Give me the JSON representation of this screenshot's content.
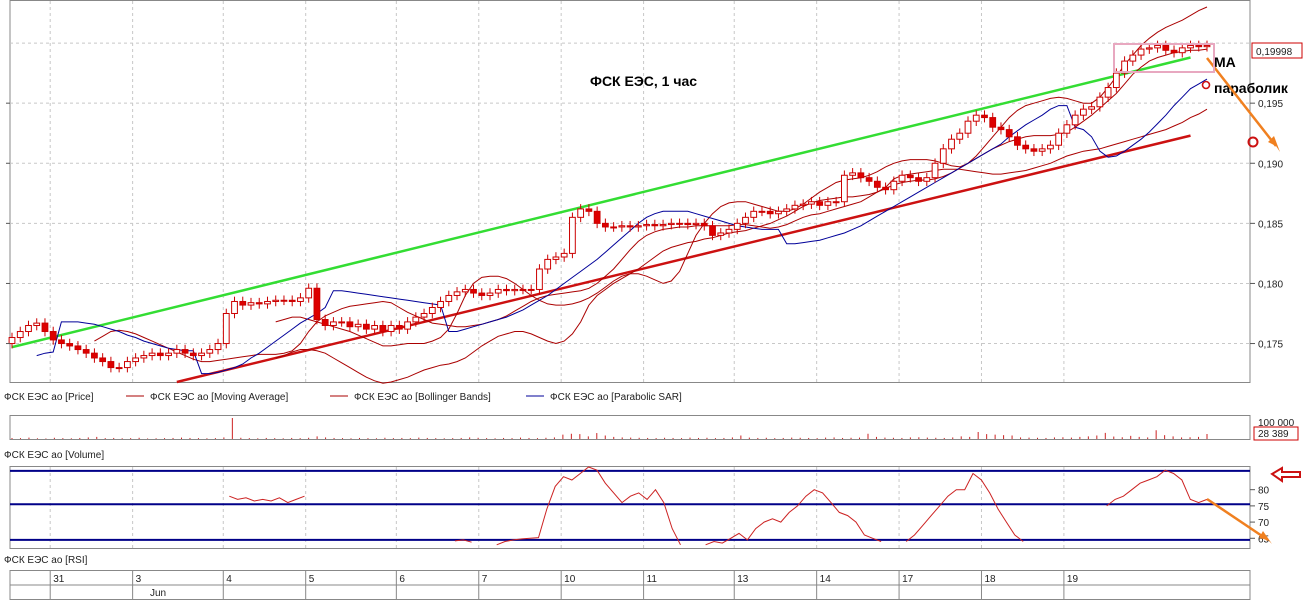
{
  "colors": {
    "grid": "#c8c8c8",
    "candle_up": "#ffffff",
    "candle_down": "#dd0000",
    "candle_outline": "#cc0000",
    "moving_average": "#aa0000",
    "bollinger": "#aa0000",
    "parabolic_sar": "#000099",
    "trend_green": "#33dd33",
    "trend_red": "#cc1111",
    "arrow_orange": "#f08020",
    "rsi_band": "#000088",
    "rsi_line": "#cc2222",
    "highlight_box": "#e8a8c0",
    "last_price_label": "#cc0000"
  },
  "chart_data": [
    {
      "type": "candlestick",
      "title": "ФСК ЕЭС,  1 час",
      "yticks": [
        0.175,
        0.18,
        0.185,
        0.19,
        0.195
      ],
      "ytick_labels": [
        "0,175",
        "0,180",
        "0,185",
        "0,190",
        "0,195"
      ],
      "ylim": [
        0.1718,
        0.2035
      ],
      "last_price_label": "0,19998",
      "legend": [
        "ФСК ЕЭС ао [Price]",
        "ФСК ЕЭС ао [Moving Average]",
        "ФСК ЕЭС ао [Bollinger Bands]",
        "ФСК ЕЭС ао [Parabolic SAR]"
      ],
      "annotations": [
        "МА",
        "параболик"
      ],
      "x_labels": [
        "31",
        "3",
        "4",
        "5",
        "6",
        "7",
        "10",
        "11",
        "13",
        "14",
        "17",
        "18",
        "19"
      ],
      "month_label": "Jun",
      "trendlines": [
        {
          "name": "upper",
          "from": [
            0,
            0.1747
          ],
          "to": [
            143,
            0.1988
          ]
        },
        {
          "name": "lower",
          "from": [
            20,
            0.1718
          ],
          "to": [
            143,
            0.1923
          ]
        }
      ],
      "closes": [
        0.1755,
        0.176,
        0.1765,
        0.1767,
        0.176,
        0.1753,
        0.175,
        0.1748,
        0.1745,
        0.1742,
        0.1738,
        0.1735,
        0.173,
        0.173,
        0.1735,
        0.1738,
        0.174,
        0.1742,
        0.174,
        0.1742,
        0.1745,
        0.1742,
        0.174,
        0.1742,
        0.1745,
        0.175,
        0.1775,
        0.1785,
        0.1782,
        0.1784,
        0.1783,
        0.1785,
        0.1786,
        0.1786,
        0.1785,
        0.1788,
        0.1796,
        0.177,
        0.1765,
        0.1768,
        0.1768,
        0.1764,
        0.1766,
        0.1762,
        0.1765,
        0.176,
        0.1765,
        0.1762,
        0.1768,
        0.1772,
        0.1775,
        0.178,
        0.1785,
        0.179,
        0.1793,
        0.1795,
        0.1792,
        0.179,
        0.1792,
        0.1795,
        0.1794,
        0.1795,
        0.1795,
        0.1795,
        0.1812,
        0.182,
        0.1822,
        0.1825,
        0.1855,
        0.1862,
        0.186,
        0.185,
        0.1847,
        0.1847,
        0.1848,
        0.1847,
        0.1848,
        0.1849,
        0.1848,
        0.1849,
        0.185,
        0.185,
        0.1849,
        0.185,
        0.1848,
        0.184,
        0.1842,
        0.1845,
        0.185,
        0.1855,
        0.186,
        0.186,
        0.1858,
        0.186,
        0.1862,
        0.1865,
        0.1866,
        0.1868,
        0.1865,
        0.1868,
        0.1868,
        0.189,
        0.1892,
        0.1888,
        0.1885,
        0.188,
        0.1878,
        0.1885,
        0.189,
        0.1888,
        0.1885,
        0.1888,
        0.19,
        0.1912,
        0.192,
        0.1925,
        0.1935,
        0.194,
        0.1938,
        0.193,
        0.1928,
        0.1922,
        0.1915,
        0.1912,
        0.191,
        0.1912,
        0.1915,
        0.1925,
        0.1932,
        0.194,
        0.1945,
        0.1947,
        0.1955,
        0.1963,
        0.1975,
        0.1985,
        0.199,
        0.1995,
        0.1996,
        0.1998,
        0.1994,
        0.1992,
        0.1996,
        0.1998,
        0.1997,
        0.1998
      ],
      "moving_average": [
        0.1752,
        0.1756,
        0.176,
        0.1761,
        0.176,
        0.1758,
        0.1755,
        0.1752,
        0.1749,
        0.1746,
        0.1743,
        0.174,
        0.1737,
        0.1735,
        0.1735,
        0.1736,
        0.1737,
        0.1738,
        0.1739,
        0.174,
        0.1741,
        0.1741,
        0.1741,
        0.1742,
        0.1744,
        0.175,
        0.176,
        0.1768,
        0.1773,
        0.1776,
        0.1779,
        0.1781,
        0.1782,
        0.1783,
        0.1784,
        0.1785,
        0.1784,
        0.178,
        0.1776,
        0.1773,
        0.177,
        0.1767,
        0.1766,
        0.1765,
        0.1764,
        0.1764,
        0.1765,
        0.1766,
        0.1768,
        0.177,
        0.1773,
        0.1777,
        0.1781,
        0.1785,
        0.1788,
        0.179,
        0.1791,
        0.1792,
        0.1793,
        0.1794,
        0.1796,
        0.18,
        0.1806,
        0.1812,
        0.182,
        0.1828,
        0.1835,
        0.184,
        0.1843,
        0.1845,
        0.1846,
        0.1847,
        0.1847,
        0.1848,
        0.1848,
        0.1848,
        0.1848,
        0.1848,
        0.1849,
        0.1849,
        0.1848,
        0.1847,
        0.1846,
        0.1847,
        0.1849,
        0.1852,
        0.1855,
        0.1857,
        0.1858,
        0.186,
        0.1862,
        0.1864,
        0.1866,
        0.1868,
        0.1872,
        0.1876,
        0.1879,
        0.1882,
        0.1884,
        0.1885,
        0.1886,
        0.1886,
        0.1887,
        0.1889,
        0.1892,
        0.1896,
        0.19,
        0.1904,
        0.1908,
        0.1912,
        0.1915,
        0.1918,
        0.192,
        0.1922,
        0.1923,
        0.1923,
        0.1923,
        0.1924,
        0.1926,
        0.193,
        0.1935,
        0.194,
        0.1946,
        0.1952,
        0.1958,
        0.1966,
        0.1974,
        0.198,
        0.1985,
        0.1988,
        0.199,
        0.1992,
        0.1993,
        0.1994,
        0.1994,
        0.1995
      ],
      "bollinger_upper": [
        0.1768,
        0.177,
        0.1772,
        0.1772,
        0.177,
        0.1768,
        0.1766,
        0.1764,
        0.1762,
        0.176,
        0.1757,
        0.1754,
        0.1751,
        0.1748,
        0.1748,
        0.1749,
        0.175,
        0.175,
        0.175,
        0.1752,
        0.1755,
        0.1762,
        0.1775,
        0.179,
        0.18,
        0.1805,
        0.1806,
        0.1806,
        0.1804,
        0.18,
        0.1795,
        0.179,
        0.1786,
        0.1783,
        0.1782,
        0.1782,
        0.1783,
        0.1785,
        0.1788,
        0.1792,
        0.1797,
        0.1802,
        0.1806,
        0.1808,
        0.1808,
        0.1806,
        0.1803,
        0.18,
        0.1802,
        0.181,
        0.1825,
        0.184,
        0.185,
        0.1858,
        0.1864,
        0.1867,
        0.1868,
        0.1868,
        0.1866,
        0.1864,
        0.1862,
        0.186,
        0.186,
        0.1862,
        0.1866,
        0.1871,
        0.1876,
        0.188,
        0.1884,
        0.1886,
        0.1887,
        0.1888,
        0.189,
        0.1893,
        0.1897,
        0.19,
        0.1902,
        0.1903,
        0.1903,
        0.1903,
        0.1902,
        0.19,
        0.1898,
        0.1897,
        0.19,
        0.1906,
        0.1914,
        0.1922,
        0.193,
        0.1938,
        0.1944,
        0.1948,
        0.195,
        0.1952,
        0.1954,
        0.1955,
        0.1954,
        0.1952,
        0.195,
        0.195,
        0.1955,
        0.1963,
        0.1972,
        0.1982,
        0.199,
        0.1998,
        0.2004,
        0.2009,
        0.2013,
        0.2016,
        0.2019,
        0.2023,
        0.2027,
        0.203
      ],
      "bollinger_lower": [
        0.1738,
        0.174,
        0.1743,
        0.1745,
        0.1745,
        0.1744,
        0.1742,
        0.1738,
        0.1734,
        0.173,
        0.1726,
        0.1722,
        0.1719,
        0.1717,
        0.1718,
        0.172,
        0.1722,
        0.1725,
        0.1728,
        0.173,
        0.1732,
        0.1733,
        0.1735,
        0.1738,
        0.1743,
        0.1748,
        0.1752,
        0.1756,
        0.1758,
        0.176,
        0.176,
        0.1758,
        0.1755,
        0.1752,
        0.175,
        0.1752,
        0.1758,
        0.1768,
        0.1782,
        0.179,
        0.1795,
        0.18,
        0.1804,
        0.1808,
        0.1812,
        0.1817,
        0.1822,
        0.1827,
        0.183,
        0.1832,
        0.1834,
        0.1835,
        0.1837,
        0.1838,
        0.184,
        0.1842,
        0.1843,
        0.1844,
        0.1846,
        0.1848,
        0.185,
        0.1853,
        0.1856,
        0.186,
        0.1864,
        0.1867,
        0.1869,
        0.187,
        0.1871,
        0.1872,
        0.1872,
        0.1873,
        0.1874,
        0.1876,
        0.188,
        0.1887,
        0.189,
        0.1891,
        0.1892,
        0.1893,
        0.1894,
        0.1895,
        0.1895,
        0.1895,
        0.1894,
        0.1893,
        0.1892,
        0.1891,
        0.1891,
        0.1892,
        0.1893,
        0.1894,
        0.1896,
        0.1898,
        0.19,
        0.1903,
        0.1906,
        0.1908,
        0.191,
        0.1911,
        0.1912,
        0.1914,
        0.1916,
        0.1918,
        0.192,
        0.1922,
        0.1924,
        0.1926,
        0.1928,
        0.1931,
        0.1934,
        0.1938,
        0.1941,
        0.1945
      ],
      "parabolic_sar": [
        0.174,
        0.1742,
        0.1743,
        0.1768,
        0.1768,
        0.1768,
        0.1767,
        0.1766,
        0.1764,
        0.1762,
        0.176,
        0.1757,
        0.1755,
        0.1752,
        0.175,
        0.1748,
        0.1746,
        0.1745,
        0.1744,
        0.1744,
        0.1725,
        0.1725,
        0.1726,
        0.1728,
        0.173,
        0.1733,
        0.1738,
        0.1742,
        0.1747,
        0.1752,
        0.1757,
        0.1762,
        0.1767,
        0.1771,
        0.1775,
        0.178,
        0.1794,
        0.1794,
        0.1793,
        0.1792,
        0.1791,
        0.179,
        0.1789,
        0.1788,
        0.1787,
        0.1786,
        0.1785,
        0.1784,
        0.1783,
        0.1782,
        0.176,
        0.176,
        0.1762,
        0.1764,
        0.1766,
        0.1768,
        0.177,
        0.1772,
        0.1775,
        0.1778,
        0.1782,
        0.1786,
        0.179,
        0.1795,
        0.18,
        0.1805,
        0.181,
        0.1815,
        0.182,
        0.1826,
        0.1832,
        0.1838,
        0.1844,
        0.185,
        0.1855,
        0.1858,
        0.186,
        0.186,
        0.186,
        0.186,
        0.1858,
        0.1856,
        0.1854,
        0.1852,
        0.185,
        0.1848,
        0.1847,
        0.1846,
        0.1845,
        0.1845,
        0.1845,
        0.1833,
        0.1833,
        0.1834,
        0.1835,
        0.1836,
        0.1838,
        0.184,
        0.1842,
        0.1845,
        0.1848,
        0.1852,
        0.1856,
        0.186,
        0.1864,
        0.1868,
        0.1872,
        0.1876,
        0.188,
        0.1884,
        0.1888,
        0.1892,
        0.1896,
        0.19,
        0.1904,
        0.1908,
        0.1912,
        0.1916,
        0.1922,
        0.1927,
        0.1932,
        0.1936,
        0.194,
        0.1945,
        0.1948,
        0.1948,
        0.193,
        0.1928,
        0.1922,
        0.191,
        0.1905,
        0.1906,
        0.191,
        0.1915,
        0.192,
        0.1926,
        0.1933,
        0.194,
        0.1948,
        0.1955,
        0.1962,
        0.1966,
        0.197
      ]
    },
    {
      "type": "bar",
      "title": "ФСК ЕЭС ао [Volume]",
      "ytick_labels": [
        "100 000"
      ],
      "last_value_label": "28 389",
      "ylim": [
        0,
        120000
      ],
      "values": [
        6000,
        5000,
        8000,
        4000,
        3000,
        7000,
        5000,
        4000,
        6000,
        9000,
        12000,
        5000,
        6000,
        4000,
        5000,
        7000,
        3000,
        4000,
        5000,
        6000,
        8000,
        6000,
        5000,
        4000,
        5000,
        9000,
        120000,
        7000,
        5000,
        4000,
        6000,
        5000,
        4000,
        6000,
        5000,
        7000,
        15000,
        9000,
        6000,
        5000,
        4000,
        6000,
        5000,
        4000,
        7000,
        5000,
        6000,
        5000,
        8000,
        6000,
        5000,
        4000,
        5000,
        6000,
        9000,
        7000,
        5000,
        4000,
        6000,
        5000,
        8000,
        6000,
        5000,
        7000,
        9000,
        25000,
        30000,
        28000,
        15000,
        34000,
        20000,
        12000,
        9000,
        8000,
        7000,
        6000,
        5000,
        7000,
        6000,
        5000,
        8000,
        6000,
        7000,
        5000,
        6000,
        9000,
        20000,
        8000,
        6000,
        7000,
        5000,
        6000,
        8000,
        7000,
        6000,
        5000,
        8000,
        9000,
        6000,
        7000,
        8000,
        30000,
        12000,
        8000,
        7000,
        6000,
        9000,
        10000,
        8000,
        7000,
        6000,
        9000,
        15000,
        12000,
        40000,
        28000,
        25000,
        22000,
        20000,
        9000,
        8000,
        7000,
        6000,
        9000,
        10000,
        8000,
        12000,
        15000,
        20000,
        35000,
        14000,
        10000,
        18000,
        12000,
        9000,
        50000,
        22000,
        15000,
        9000,
        10000,
        12000,
        28389
      ]
    },
    {
      "type": "line",
      "title": "ФСК ЕЭС ао [RSI]",
      "yticks": [
        65,
        70,
        75,
        80
      ],
      "ytick_labels": [
        "65",
        "70",
        "75",
        "80"
      ],
      "ylim": [
        62,
        87
      ],
      "levels": [
        64.5,
        75.5,
        85.8
      ],
      "values": [
        null,
        null,
        null,
        null,
        null,
        null,
        null,
        null,
        null,
        null,
        null,
        null,
        null,
        null,
        null,
        null,
        null,
        null,
        null,
        null,
        null,
        null,
        null,
        null,
        null,
        null,
        78,
        77,
        77.5,
        76.5,
        77,
        76.5,
        77.5,
        76,
        77,
        78,
        null,
        null,
        null,
        null,
        null,
        null,
        null,
        null,
        null,
        null,
        null,
        null,
        null,
        null,
        null,
        null,
        null,
        64.2,
        64.5,
        63.8,
        null,
        null,
        63,
        64,
        64.5,
        64.8,
        65,
        65.2,
        74,
        81,
        84,
        83,
        85,
        88,
        86,
        82,
        79,
        76,
        78,
        79,
        77,
        80,
        76,
        68,
        63,
        null,
        null,
        63,
        64,
        63.5,
        65,
        66.5,
        64.5,
        68,
        70,
        71,
        70,
        73,
        75,
        78,
        80,
        79,
        76,
        73,
        72,
        70,
        66,
        65,
        64,
        null,
        null,
        64,
        66,
        69,
        72,
        75,
        78,
        80,
        80,
        85,
        83,
        79,
        74,
        70,
        66,
        64,
        null,
        null,
        null,
        null,
        null,
        null,
        null,
        null,
        null,
        75,
        77,
        78,
        80,
        82,
        83,
        84,
        86,
        85,
        83,
        77,
        76,
        77
      ]
    }
  ]
}
